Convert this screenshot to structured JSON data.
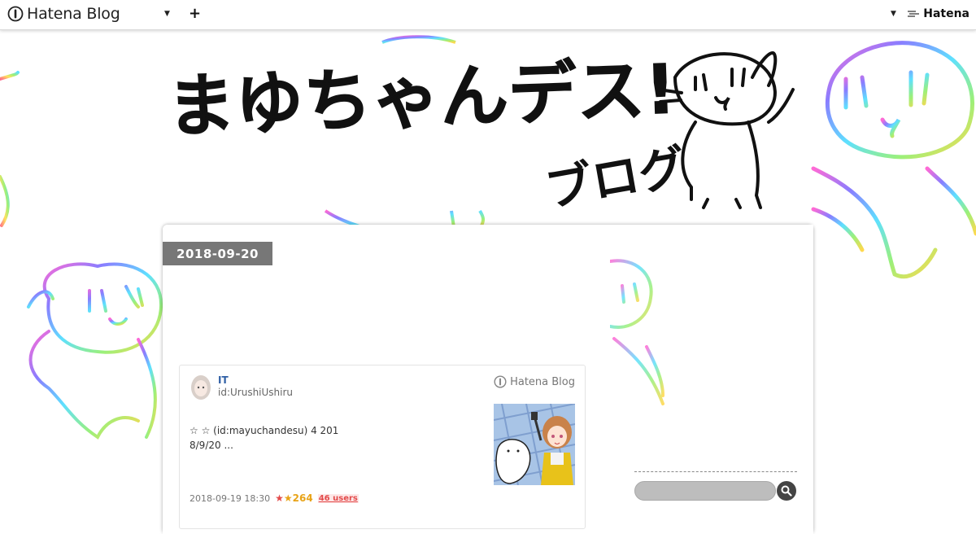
{
  "globalbar": {
    "logo_text": "Hatena Blog",
    "plus": "+",
    "right_text": "Hatena"
  },
  "header": {
    "title": "まゆちゃんデス!",
    "subtitle": "ブログ"
  },
  "entry": {
    "date": "2018-09-20"
  },
  "embed": {
    "title": "IT",
    "author_id": "id:UrushiUshiru",
    "brand": "Hatena Blog",
    "text_line1": "☆ ☆ (id:mayuchandesu) 4    201",
    "text_line2": "8/9/20 ...",
    "timestamp": "2018-09-19 18:30",
    "star_count": "264",
    "users": "46 users"
  },
  "colors": {
    "date_badge": "#777777",
    "link_blue": "#2f5fa5",
    "star_red": "#e34b4b",
    "star_gold": "#e8a317"
  }
}
